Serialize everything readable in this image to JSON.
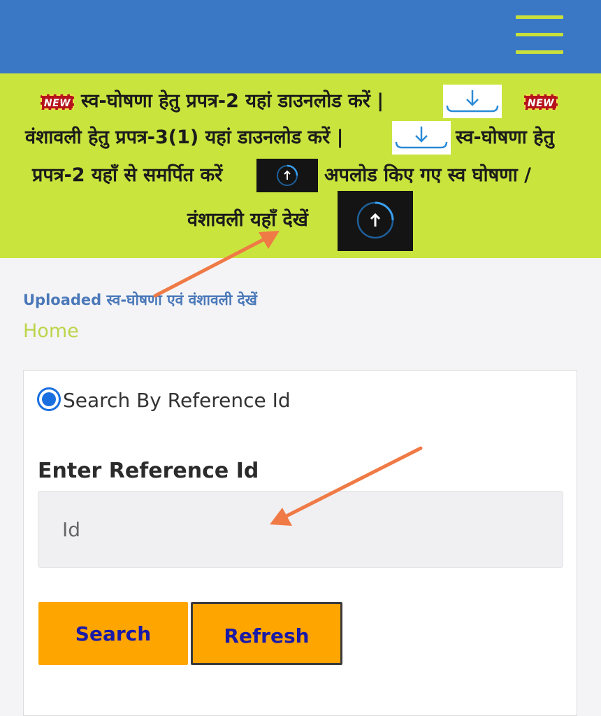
{
  "header": {
    "menu_icon": "hamburger-menu-icon",
    "colors": {
      "bar": "#3a78c6",
      "menu": "#c9e03a"
    }
  },
  "notice": {
    "background": "#c9e43d",
    "new_badge": "NEW",
    "line1_text": "स्व-घोषणा हेतु प्रपत्र-2 यहां डाउनलोड करें |",
    "line2_text": "वंशावली हेतु प्रपत्र-3(1) यहां डाउनलोड करें |",
    "line2_tail": "स्व-घोषणा हेतु",
    "line3_text": "प्रपत्र-2 यहाँ से समर्पित करें",
    "line3_tail": "अपलोड किए गए स्व घोषणा /",
    "line4_text": "वंशावली यहाँ देखें",
    "download_icon": "download-icon",
    "upload_icon": "upload-icon"
  },
  "links": {
    "uploaded": "Uploaded स्व-घोषणा एवं वंशावली देखें",
    "home": "Home"
  },
  "form": {
    "radio_label": "Search By Reference Id",
    "radio_checked": true,
    "field_label": "Enter Reference Id",
    "input_placeholder": "Id",
    "input_value": "",
    "search_label": "Search",
    "refresh_label": "Refresh",
    "button_color": "#ffa500",
    "button_text_color": "#1a1aa8"
  }
}
